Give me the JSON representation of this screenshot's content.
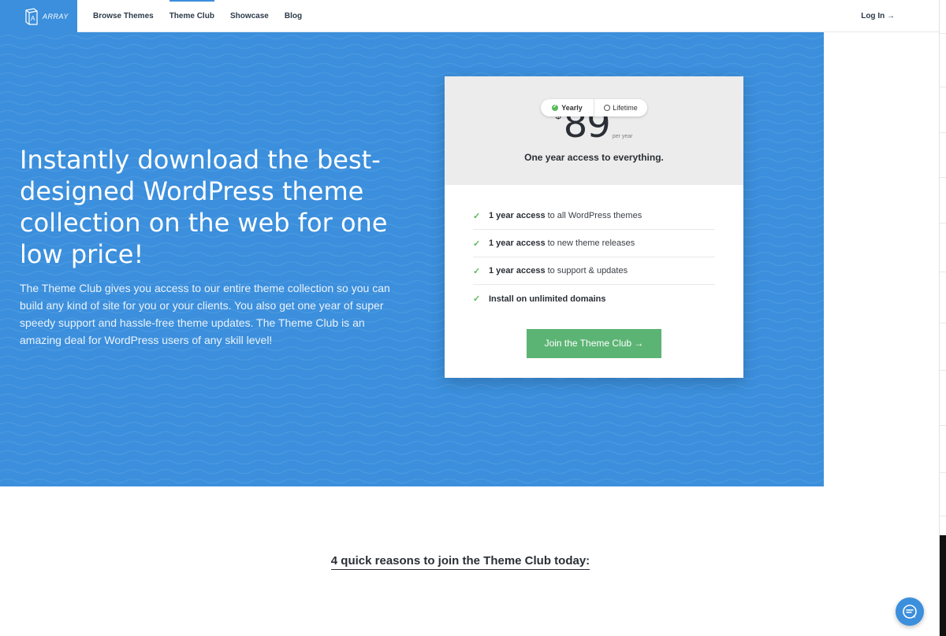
{
  "header": {
    "logo_text": "ARRAY",
    "nav": [
      "Browse Themes",
      "Theme Club",
      "Showcase",
      "Blog"
    ],
    "active_nav": "Theme Club",
    "login": "Log In →"
  },
  "hero": {
    "headline": "Instantly download the best-designed WordPress theme collection on the web for one low price!",
    "subtext": "The Theme Club gives you access to our entire theme collection so you can build any kind of site for you or your clients. You also get one year of super speedy support and hassle-free theme updates. The Theme Club is an amazing deal for WordPress users of any skill level!"
  },
  "pricing": {
    "toggle": {
      "yearly": "Yearly",
      "lifetime": "Lifetime",
      "selected": "Yearly"
    },
    "currency": "$",
    "amount": "89",
    "period": "per year",
    "tagline": "One year access to everything.",
    "features": [
      {
        "bold": "1 year access",
        "rest": "to all WordPress themes"
      },
      {
        "bold": "1 year access",
        "rest": "to new theme releases"
      },
      {
        "bold": "1 year access",
        "rest": "to support & updates"
      },
      {
        "bold": "Install on unlimited domains",
        "rest": ""
      }
    ],
    "cta": "Join the Theme Club →"
  },
  "reasons_heading": "4 quick reasons to join the Theme Club today:",
  "colors": {
    "brand_blue": "#3b8fdc",
    "cta_green": "#5cb474",
    "check_green": "#5cb85c"
  }
}
